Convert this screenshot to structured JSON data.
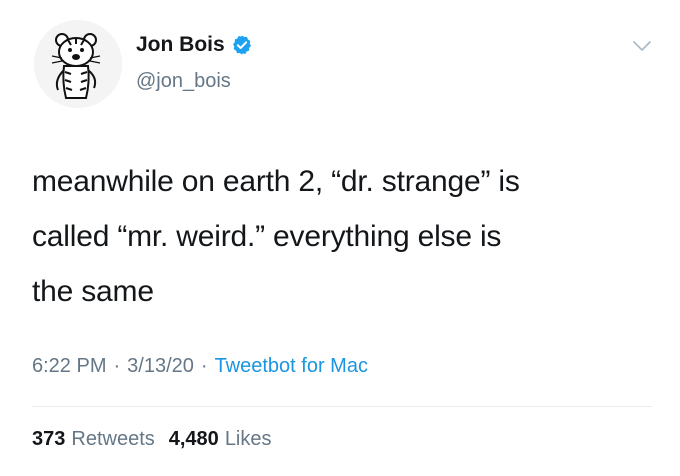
{
  "author": {
    "display_name": "Jon Bois",
    "handle": "@jon_bois",
    "verified": true,
    "avatar_icon": "calvin-and-hobbes-tiger-avatar"
  },
  "tweet": {
    "text": "meanwhile on earth 2, “dr. strange” is\ncalled “mr. weird.” everything else is\nthe same"
  },
  "meta": {
    "time": "6:22 PM",
    "separator": "·",
    "date": "3/13/20",
    "source": "Tweetbot for Mac"
  },
  "stats": {
    "retweets_count": "373",
    "retweets_label": "Retweets",
    "likes_count": "4,480",
    "likes_label": "Likes"
  },
  "colors": {
    "verified_blue": "#1da1f2",
    "source_link": "#1b95e0",
    "secondary_text": "#657786"
  },
  "icons": {
    "menu": "chevron-down-icon",
    "verified": "verified-badge-icon"
  }
}
